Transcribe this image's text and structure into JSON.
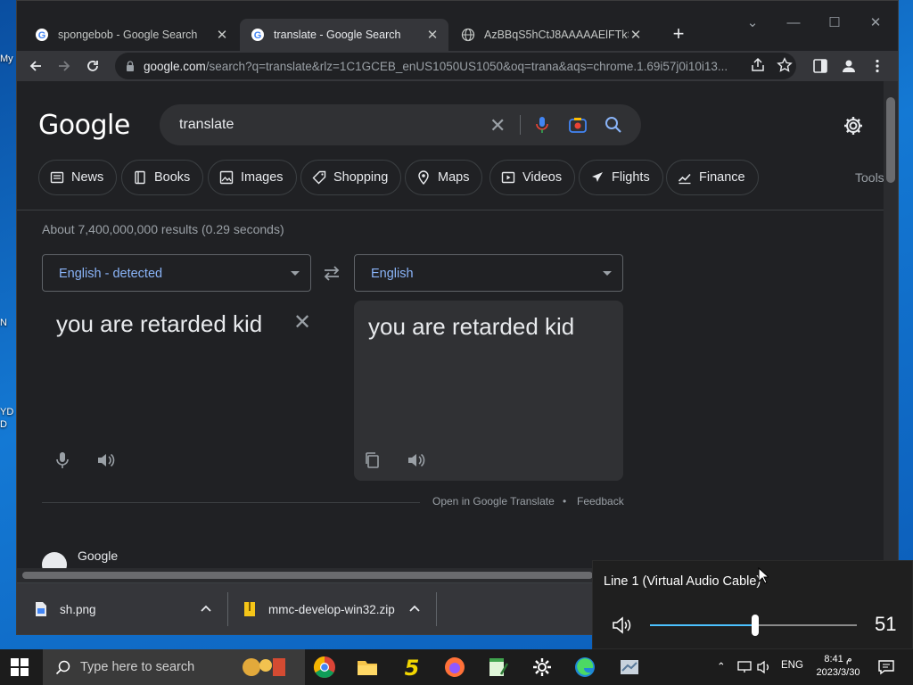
{
  "desktop": {
    "fragments": [
      "My",
      "N",
      "YD",
      "D"
    ]
  },
  "browser": {
    "tabs": [
      {
        "title": "spongebob - Google Search",
        "active": false
      },
      {
        "title": "translate - Google Search",
        "active": true
      },
      {
        "title": "AzBBqS5hCtJ8AAAAAElFTkSuQmCC",
        "active": false
      }
    ],
    "url_host": "google.com",
    "url_rest": "/search?q=translate&rlz=1C1GCEB_enUS1050US1050&oq=trana&aqs=chrome.1.69i57j0i10i13..."
  },
  "search": {
    "logo": "Google",
    "query": "translate",
    "chips": [
      "News",
      "Books",
      "Images",
      "Shopping",
      "Maps",
      "Videos",
      "Flights",
      "Finance"
    ],
    "tools": "Tools",
    "stats": "About 7,400,000,000 results (0.29 seconds)"
  },
  "translate": {
    "source_lang": "English - detected",
    "target_lang": "English",
    "source_text": "you are retarded kid",
    "target_text": "you are retarded kid",
    "open_link": "Open in Google Translate",
    "dot": "•",
    "feedback": "Feedback"
  },
  "result": {
    "title": "Google"
  },
  "downloads": [
    {
      "name": "sh.png"
    },
    {
      "name": "mmc-develop-win32.zip"
    }
  ],
  "volume": {
    "device": "Line 1 (Virtual Audio Cable)",
    "level": 51,
    "accent": "#4cc2ff"
  },
  "taskbar": {
    "search_placeholder": "Type here to search",
    "language": "ENG",
    "time": "8:41 م",
    "date": "2023/3/30"
  }
}
